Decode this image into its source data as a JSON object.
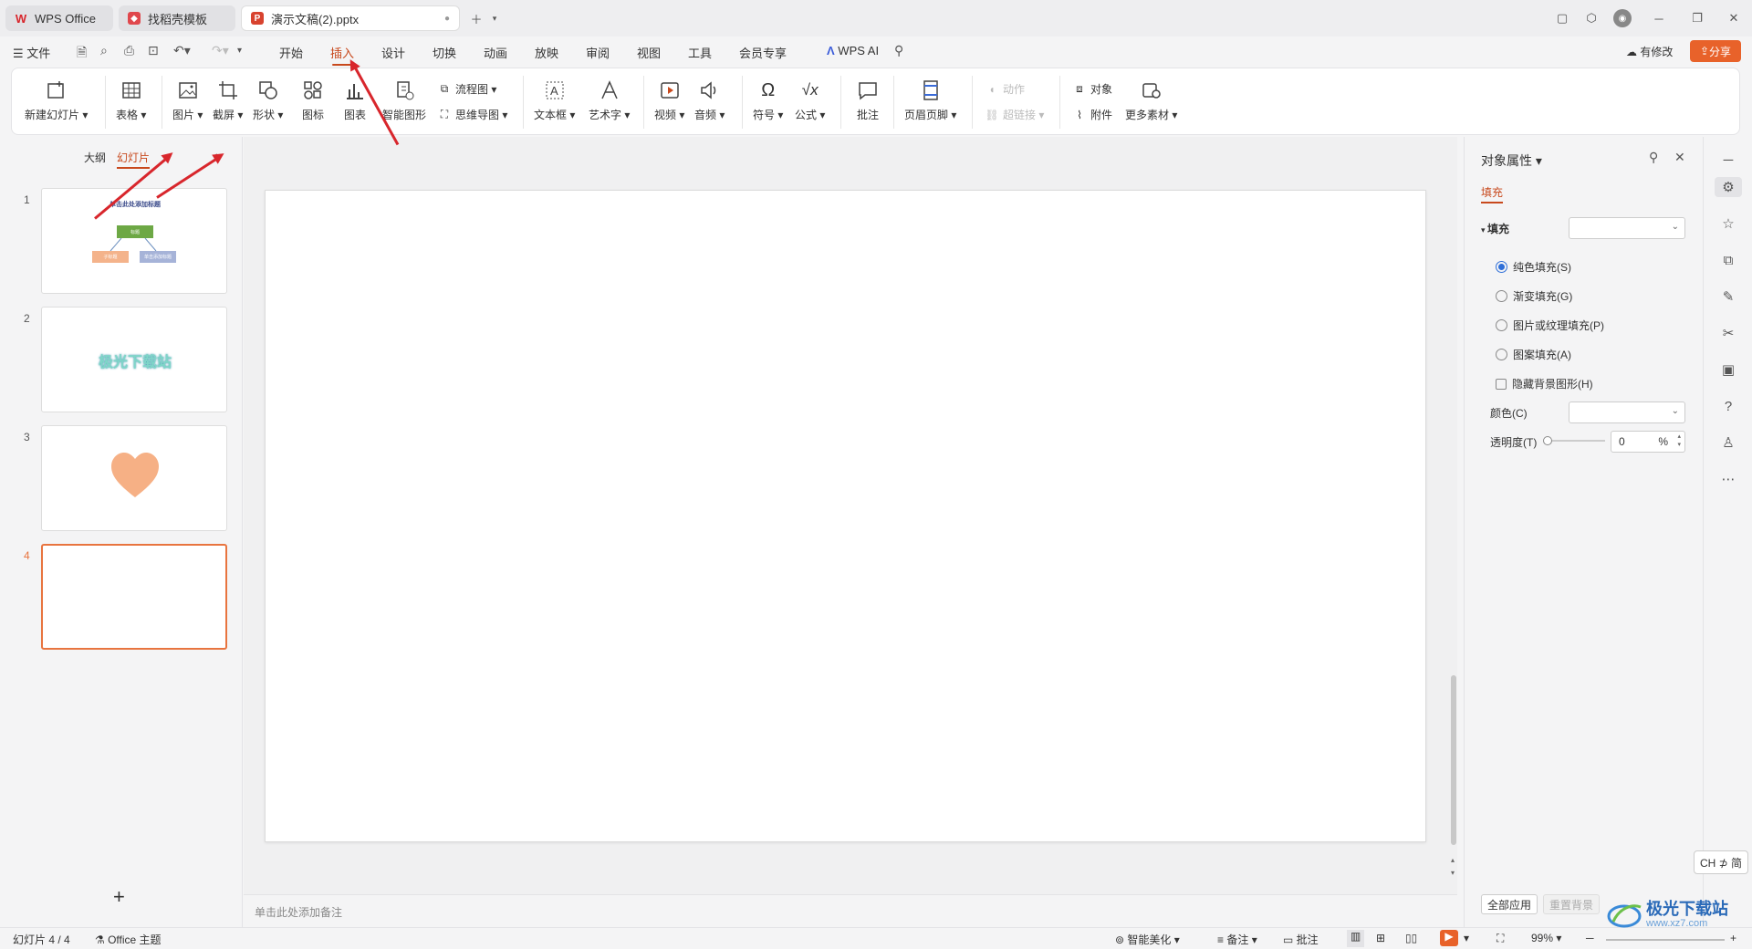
{
  "tabs": [
    {
      "label": "WPS Office"
    },
    {
      "label": "找稻壳模板"
    },
    {
      "label": "演示文稿(2).pptx"
    }
  ],
  "menu": {
    "file_label": "文件",
    "items": [
      "开始",
      "插入",
      "设计",
      "切换",
      "动画",
      "放映",
      "审阅",
      "视图",
      "工具",
      "会员专享"
    ],
    "active": "插入",
    "wps_ai": "WPS AI",
    "modified": "有修改",
    "share": "分享"
  },
  "ribbon": {
    "new_slide": "新建幻灯片",
    "table": "表格",
    "picture": "图片",
    "screenshot": "截屏",
    "shape": "形状",
    "icon": "图标",
    "chart": "图表",
    "smartart": "智能图形",
    "flowchart": "流程图",
    "mindmap": "思维导图",
    "textbox": "文本框",
    "wordart": "艺术字",
    "video": "视频",
    "audio": "音频",
    "symbol": "符号",
    "formula": "公式",
    "comment": "批注",
    "header_footer": "页眉页脚",
    "action": "动作",
    "hyperlink": "超链接",
    "object": "对象",
    "attachment": "附件",
    "more_material": "更多素材"
  },
  "left_panel": {
    "tab_outline": "大纲",
    "tab_slides": "幻灯片",
    "slides": [
      {
        "num": "1",
        "title": "单击此处添加标题",
        "box": "标题",
        "left": "子标题",
        "right": "单击添加标题"
      },
      {
        "num": "2",
        "text": "极光下载站"
      },
      {
        "num": "3"
      },
      {
        "num": "4"
      }
    ]
  },
  "notes_placeholder": "单击此处添加备注",
  "right_panel": {
    "title": "对象属性",
    "tab_fill": "填充",
    "section_fill": "填充",
    "options": [
      "纯色填充(S)",
      "渐变填充(G)",
      "图片或纹理填充(P)",
      "图案填充(A)"
    ],
    "selected_option": "纯色填充(S)",
    "hide_bg": "隐藏背景图形(H)",
    "color_label": "颜色(C)",
    "transparency_label": "透明度(T)",
    "transparency_value": "0",
    "percent": "%",
    "apply_all": "全部应用",
    "reset_bg": "重置背景"
  },
  "ime": "CH ⊅ 简",
  "statusbar": {
    "slide_count": "幻灯片 4 / 4",
    "theme": "Office 主题",
    "beautify": "智能美化",
    "notes": "备注",
    "comments": "批注",
    "zoom": "99%"
  },
  "watermark": "极光下载站",
  "watermark_url": "www.xz7.com",
  "colors": {
    "accent": "#c8491d",
    "share_bg": "#e8622a",
    "arrow": "#d8262c",
    "selected_slide": "#e8743f"
  }
}
